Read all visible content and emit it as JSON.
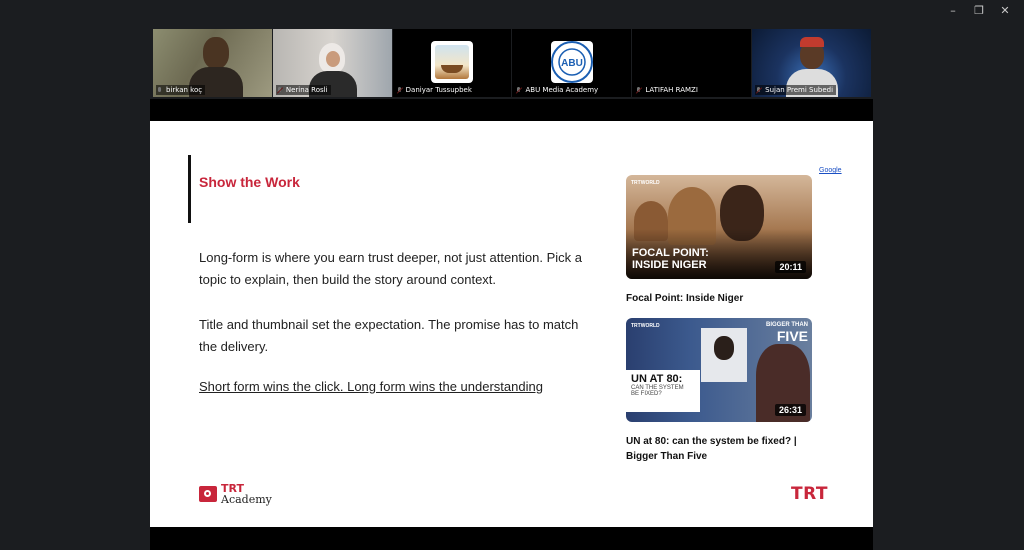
{
  "window_controls": {
    "minimize": "–",
    "restore": "❐",
    "close": "✕"
  },
  "participants": [
    {
      "name": "birkan koç",
      "muted": false,
      "active_speaker": true,
      "kind": "video"
    },
    {
      "name": "Nerina Rosli",
      "muted": true,
      "active_speaker": false,
      "kind": "video"
    },
    {
      "name": "Daniyar Tussupbek",
      "muted": true,
      "active_speaker": false,
      "kind": "avatar-ship"
    },
    {
      "name": "ABU Media Academy",
      "muted": true,
      "active_speaker": false,
      "kind": "avatar-abu"
    },
    {
      "name": "LATIFAH RAMZI",
      "muted": true,
      "active_speaker": false,
      "kind": "off"
    },
    {
      "name": "Sujan Premi Subedi",
      "muted": true,
      "active_speaker": false,
      "kind": "video"
    }
  ],
  "slide": {
    "title": "Show the Work",
    "paragraph1": "Long-form is where you earn trust deeper, not just attention. Pick a topic to explain, then build the story around context.",
    "paragraph2": "Title and thumbnail set the expectation. The promise has to match the delivery.",
    "link_text": "Short form wins the click. Long form wins the understanding",
    "google_link": "Google",
    "videos": [
      {
        "thumb_tag": "TRTWORLD",
        "thumb_title_line1": "FOCAL POINT:",
        "thumb_title_line2": "INSIDE NIGER",
        "duration": "20:11",
        "title": "Focal Point: Inside Niger"
      },
      {
        "thumb_tag": "TRTWORLD",
        "thumb_banner_1": "BIGGER THAN",
        "thumb_banner_2": "FIVE",
        "thumb_un_1": "UN AT 80:",
        "thumb_un_2": "CAN THE SYSTEM",
        "thumb_un_3": "BE FIXED?",
        "duration": "26:31",
        "title": "UN at 80: can the system be fixed? | Bigger Than Five"
      }
    ],
    "brand_academy_1": "TRT",
    "brand_academy_2": "Academy",
    "brand_trt": "TRT"
  },
  "colors": {
    "accent_red": "#c8263b",
    "active_speaker": "#2ec25a",
    "background": "#1b1d20"
  }
}
